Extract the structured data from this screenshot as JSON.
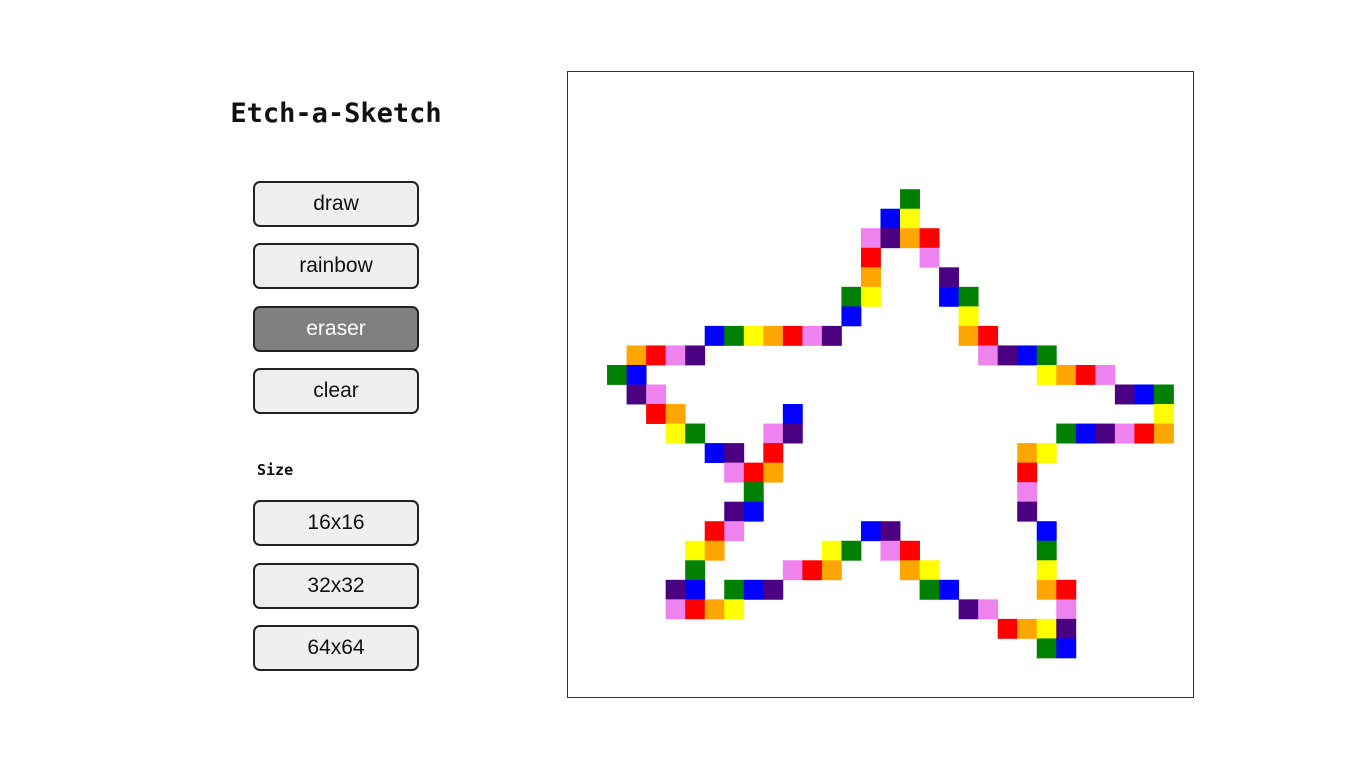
{
  "app": {
    "title": "Etch-a-Sketch"
  },
  "mode_buttons": [
    {
      "label": "draw",
      "active": false
    },
    {
      "label": "rainbow",
      "active": false
    },
    {
      "label": "eraser",
      "active": true
    },
    {
      "label": "clear",
      "active": false
    }
  ],
  "size": {
    "label": "Size",
    "options": [
      {
        "label": "16x16"
      },
      {
        "label": "32x32"
      },
      {
        "label": "64x64"
      }
    ]
  },
  "board": {
    "grid_size": 32,
    "background_color": "#ffffff",
    "palette": {
      "R": "#ff0000",
      "O": "#ffa500",
      "Y": "#ffff00",
      "G": "#008000",
      "B": "#0000ff",
      "I": "#4b0082",
      "V": "#ee82ee"
    },
    "painted_cells": [
      [
        6,
        17,
        "G"
      ],
      [
        7,
        16,
        "B"
      ],
      [
        7,
        17,
        "Y"
      ],
      [
        8,
        15,
        "V"
      ],
      [
        8,
        16,
        "I"
      ],
      [
        8,
        17,
        "O"
      ],
      [
        8,
        18,
        "R"
      ],
      [
        9,
        15,
        "R"
      ],
      [
        9,
        18,
        "V"
      ],
      [
        10,
        15,
        "O"
      ],
      [
        10,
        19,
        "I"
      ],
      [
        11,
        14,
        "G"
      ],
      [
        11,
        15,
        "Y"
      ],
      [
        11,
        19,
        "B"
      ],
      [
        11,
        20,
        "G"
      ],
      [
        12,
        14,
        "B"
      ],
      [
        12,
        20,
        "Y"
      ],
      [
        13,
        7,
        "B"
      ],
      [
        13,
        8,
        "G"
      ],
      [
        13,
        9,
        "Y"
      ],
      [
        13,
        10,
        "O"
      ],
      [
        13,
        11,
        "R"
      ],
      [
        13,
        12,
        "V"
      ],
      [
        13,
        13,
        "I"
      ],
      [
        13,
        20,
        "O"
      ],
      [
        13,
        21,
        "R"
      ],
      [
        14,
        3,
        "O"
      ],
      [
        14,
        4,
        "R"
      ],
      [
        14,
        5,
        "V"
      ],
      [
        14,
        6,
        "I"
      ],
      [
        14,
        21,
        "V"
      ],
      [
        14,
        22,
        "I"
      ],
      [
        14,
        23,
        "B"
      ],
      [
        14,
        24,
        "G"
      ],
      [
        15,
        2,
        "G"
      ],
      [
        15,
        3,
        "B"
      ],
      [
        15,
        24,
        "Y"
      ],
      [
        15,
        25,
        "O"
      ],
      [
        15,
        26,
        "R"
      ],
      [
        15,
        27,
        "V"
      ],
      [
        16,
        3,
        "I"
      ],
      [
        16,
        4,
        "V"
      ],
      [
        16,
        28,
        "I"
      ],
      [
        16,
        29,
        "B"
      ],
      [
        16,
        30,
        "G"
      ],
      [
        17,
        4,
        "R"
      ],
      [
        17,
        5,
        "O"
      ],
      [
        17,
        11,
        "B"
      ],
      [
        17,
        30,
        "Y"
      ],
      [
        18,
        5,
        "Y"
      ],
      [
        18,
        6,
        "G"
      ],
      [
        18,
        10,
        "V"
      ],
      [
        18,
        11,
        "I"
      ],
      [
        18,
        25,
        "G"
      ],
      [
        18,
        26,
        "B"
      ],
      [
        18,
        27,
        "I"
      ],
      [
        18,
        28,
        "V"
      ],
      [
        18,
        29,
        "R"
      ],
      [
        18,
        30,
        "O"
      ],
      [
        19,
        7,
        "B"
      ],
      [
        19,
        8,
        "I"
      ],
      [
        19,
        10,
        "R"
      ],
      [
        19,
        23,
        "O"
      ],
      [
        19,
        24,
        "Y"
      ],
      [
        20,
        8,
        "V"
      ],
      [
        20,
        9,
        "R"
      ],
      [
        20,
        10,
        "O"
      ],
      [
        20,
        23,
        "R"
      ],
      [
        21,
        9,
        "G"
      ],
      [
        21,
        23,
        "V"
      ],
      [
        22,
        8,
        "I"
      ],
      [
        22,
        9,
        "B"
      ],
      [
        22,
        23,
        "I"
      ],
      [
        23,
        7,
        "R"
      ],
      [
        23,
        8,
        "V"
      ],
      [
        23,
        15,
        "B"
      ],
      [
        23,
        16,
        "I"
      ],
      [
        23,
        24,
        "B"
      ],
      [
        24,
        6,
        "Y"
      ],
      [
        24,
        7,
        "O"
      ],
      [
        24,
        13,
        "Y"
      ],
      [
        24,
        14,
        "G"
      ],
      [
        24,
        16,
        "V"
      ],
      [
        24,
        17,
        "R"
      ],
      [
        24,
        24,
        "G"
      ],
      [
        25,
        6,
        "G"
      ],
      [
        25,
        11,
        "V"
      ],
      [
        25,
        12,
        "R"
      ],
      [
        25,
        13,
        "O"
      ],
      [
        25,
        17,
        "O"
      ],
      [
        25,
        18,
        "Y"
      ],
      [
        25,
        24,
        "Y"
      ],
      [
        26,
        5,
        "I"
      ],
      [
        26,
        6,
        "B"
      ],
      [
        26,
        8,
        "G"
      ],
      [
        26,
        9,
        "B"
      ],
      [
        26,
        10,
        "I"
      ],
      [
        26,
        18,
        "G"
      ],
      [
        26,
        19,
        "B"
      ],
      [
        26,
        24,
        "O"
      ],
      [
        26,
        25,
        "R"
      ],
      [
        27,
        5,
        "V"
      ],
      [
        27,
        6,
        "R"
      ],
      [
        27,
        7,
        "O"
      ],
      [
        27,
        8,
        "Y"
      ],
      [
        27,
        20,
        "I"
      ],
      [
        27,
        21,
        "V"
      ],
      [
        27,
        25,
        "V"
      ],
      [
        28,
        22,
        "R"
      ],
      [
        28,
        23,
        "O"
      ],
      [
        28,
        24,
        "Y"
      ],
      [
        28,
        25,
        "I"
      ],
      [
        29,
        24,
        "G"
      ],
      [
        29,
        25,
        "B"
      ]
    ]
  }
}
